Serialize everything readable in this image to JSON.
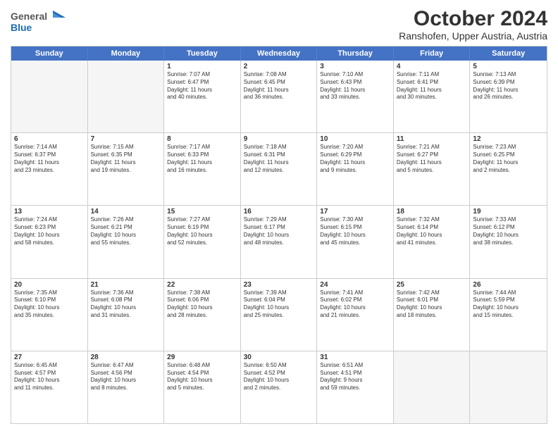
{
  "header": {
    "logo_line1": "General",
    "logo_line2": "Blue",
    "title": "October 2024",
    "subtitle": "Ranshofen, Upper Austria, Austria"
  },
  "calendar": {
    "days": [
      "Sunday",
      "Monday",
      "Tuesday",
      "Wednesday",
      "Thursday",
      "Friday",
      "Saturday"
    ],
    "rows": [
      [
        {
          "day": "",
          "empty": true
        },
        {
          "day": "",
          "empty": true
        },
        {
          "day": "1",
          "lines": [
            "Sunrise: 7:07 AM",
            "Sunset: 6:47 PM",
            "Daylight: 11 hours",
            "and 40 minutes."
          ]
        },
        {
          "day": "2",
          "lines": [
            "Sunrise: 7:08 AM",
            "Sunset: 6:45 PM",
            "Daylight: 11 hours",
            "and 36 minutes."
          ]
        },
        {
          "day": "3",
          "lines": [
            "Sunrise: 7:10 AM",
            "Sunset: 6:43 PM",
            "Daylight: 11 hours",
            "and 33 minutes."
          ]
        },
        {
          "day": "4",
          "lines": [
            "Sunrise: 7:11 AM",
            "Sunset: 6:41 PM",
            "Daylight: 11 hours",
            "and 30 minutes."
          ]
        },
        {
          "day": "5",
          "lines": [
            "Sunrise: 7:13 AM",
            "Sunset: 6:39 PM",
            "Daylight: 11 hours",
            "and 26 minutes."
          ]
        }
      ],
      [
        {
          "day": "6",
          "lines": [
            "Sunrise: 7:14 AM",
            "Sunset: 6:37 PM",
            "Daylight: 11 hours",
            "and 23 minutes."
          ]
        },
        {
          "day": "7",
          "lines": [
            "Sunrise: 7:15 AM",
            "Sunset: 6:35 PM",
            "Daylight: 11 hours",
            "and 19 minutes."
          ]
        },
        {
          "day": "8",
          "lines": [
            "Sunrise: 7:17 AM",
            "Sunset: 6:33 PM",
            "Daylight: 11 hours",
            "and 16 minutes."
          ]
        },
        {
          "day": "9",
          "lines": [
            "Sunrise: 7:18 AM",
            "Sunset: 6:31 PM",
            "Daylight: 11 hours",
            "and 12 minutes."
          ]
        },
        {
          "day": "10",
          "lines": [
            "Sunrise: 7:20 AM",
            "Sunset: 6:29 PM",
            "Daylight: 11 hours",
            "and 9 minutes."
          ]
        },
        {
          "day": "11",
          "lines": [
            "Sunrise: 7:21 AM",
            "Sunset: 6:27 PM",
            "Daylight: 11 hours",
            "and 5 minutes."
          ]
        },
        {
          "day": "12",
          "lines": [
            "Sunrise: 7:23 AM",
            "Sunset: 6:25 PM",
            "Daylight: 11 hours",
            "and 2 minutes."
          ]
        }
      ],
      [
        {
          "day": "13",
          "lines": [
            "Sunrise: 7:24 AM",
            "Sunset: 6:23 PM",
            "Daylight: 10 hours",
            "and 58 minutes."
          ]
        },
        {
          "day": "14",
          "lines": [
            "Sunrise: 7:26 AM",
            "Sunset: 6:21 PM",
            "Daylight: 10 hours",
            "and 55 minutes."
          ]
        },
        {
          "day": "15",
          "lines": [
            "Sunrise: 7:27 AM",
            "Sunset: 6:19 PM",
            "Daylight: 10 hours",
            "and 52 minutes."
          ]
        },
        {
          "day": "16",
          "lines": [
            "Sunrise: 7:29 AM",
            "Sunset: 6:17 PM",
            "Daylight: 10 hours",
            "and 48 minutes."
          ]
        },
        {
          "day": "17",
          "lines": [
            "Sunrise: 7:30 AM",
            "Sunset: 6:15 PM",
            "Daylight: 10 hours",
            "and 45 minutes."
          ]
        },
        {
          "day": "18",
          "lines": [
            "Sunrise: 7:32 AM",
            "Sunset: 6:14 PM",
            "Daylight: 10 hours",
            "and 41 minutes."
          ]
        },
        {
          "day": "19",
          "lines": [
            "Sunrise: 7:33 AM",
            "Sunset: 6:12 PM",
            "Daylight: 10 hours",
            "and 38 minutes."
          ]
        }
      ],
      [
        {
          "day": "20",
          "lines": [
            "Sunrise: 7:35 AM",
            "Sunset: 6:10 PM",
            "Daylight: 10 hours",
            "and 35 minutes."
          ]
        },
        {
          "day": "21",
          "lines": [
            "Sunrise: 7:36 AM",
            "Sunset: 6:08 PM",
            "Daylight: 10 hours",
            "and 31 minutes."
          ]
        },
        {
          "day": "22",
          "lines": [
            "Sunrise: 7:38 AM",
            "Sunset: 6:06 PM",
            "Daylight: 10 hours",
            "and 28 minutes."
          ]
        },
        {
          "day": "23",
          "lines": [
            "Sunrise: 7:39 AM",
            "Sunset: 6:04 PM",
            "Daylight: 10 hours",
            "and 25 minutes."
          ]
        },
        {
          "day": "24",
          "lines": [
            "Sunrise: 7:41 AM",
            "Sunset: 6:02 PM",
            "Daylight: 10 hours",
            "and 21 minutes."
          ]
        },
        {
          "day": "25",
          "lines": [
            "Sunrise: 7:42 AM",
            "Sunset: 6:01 PM",
            "Daylight: 10 hours",
            "and 18 minutes."
          ]
        },
        {
          "day": "26",
          "lines": [
            "Sunrise: 7:44 AM",
            "Sunset: 5:59 PM",
            "Daylight: 10 hours",
            "and 15 minutes."
          ]
        }
      ],
      [
        {
          "day": "27",
          "lines": [
            "Sunrise: 6:45 AM",
            "Sunset: 4:57 PM",
            "Daylight: 10 hours",
            "and 11 minutes."
          ]
        },
        {
          "day": "28",
          "lines": [
            "Sunrise: 6:47 AM",
            "Sunset: 4:56 PM",
            "Daylight: 10 hours",
            "and 8 minutes."
          ]
        },
        {
          "day": "29",
          "lines": [
            "Sunrise: 6:48 AM",
            "Sunset: 4:54 PM",
            "Daylight: 10 hours",
            "and 5 minutes."
          ]
        },
        {
          "day": "30",
          "lines": [
            "Sunrise: 6:50 AM",
            "Sunset: 4:52 PM",
            "Daylight: 10 hours",
            "and 2 minutes."
          ]
        },
        {
          "day": "31",
          "lines": [
            "Sunrise: 6:51 AM",
            "Sunset: 4:51 PM",
            "Daylight: 9 hours",
            "and 59 minutes."
          ]
        },
        {
          "day": "",
          "empty": true
        },
        {
          "day": "",
          "empty": true
        }
      ]
    ]
  }
}
